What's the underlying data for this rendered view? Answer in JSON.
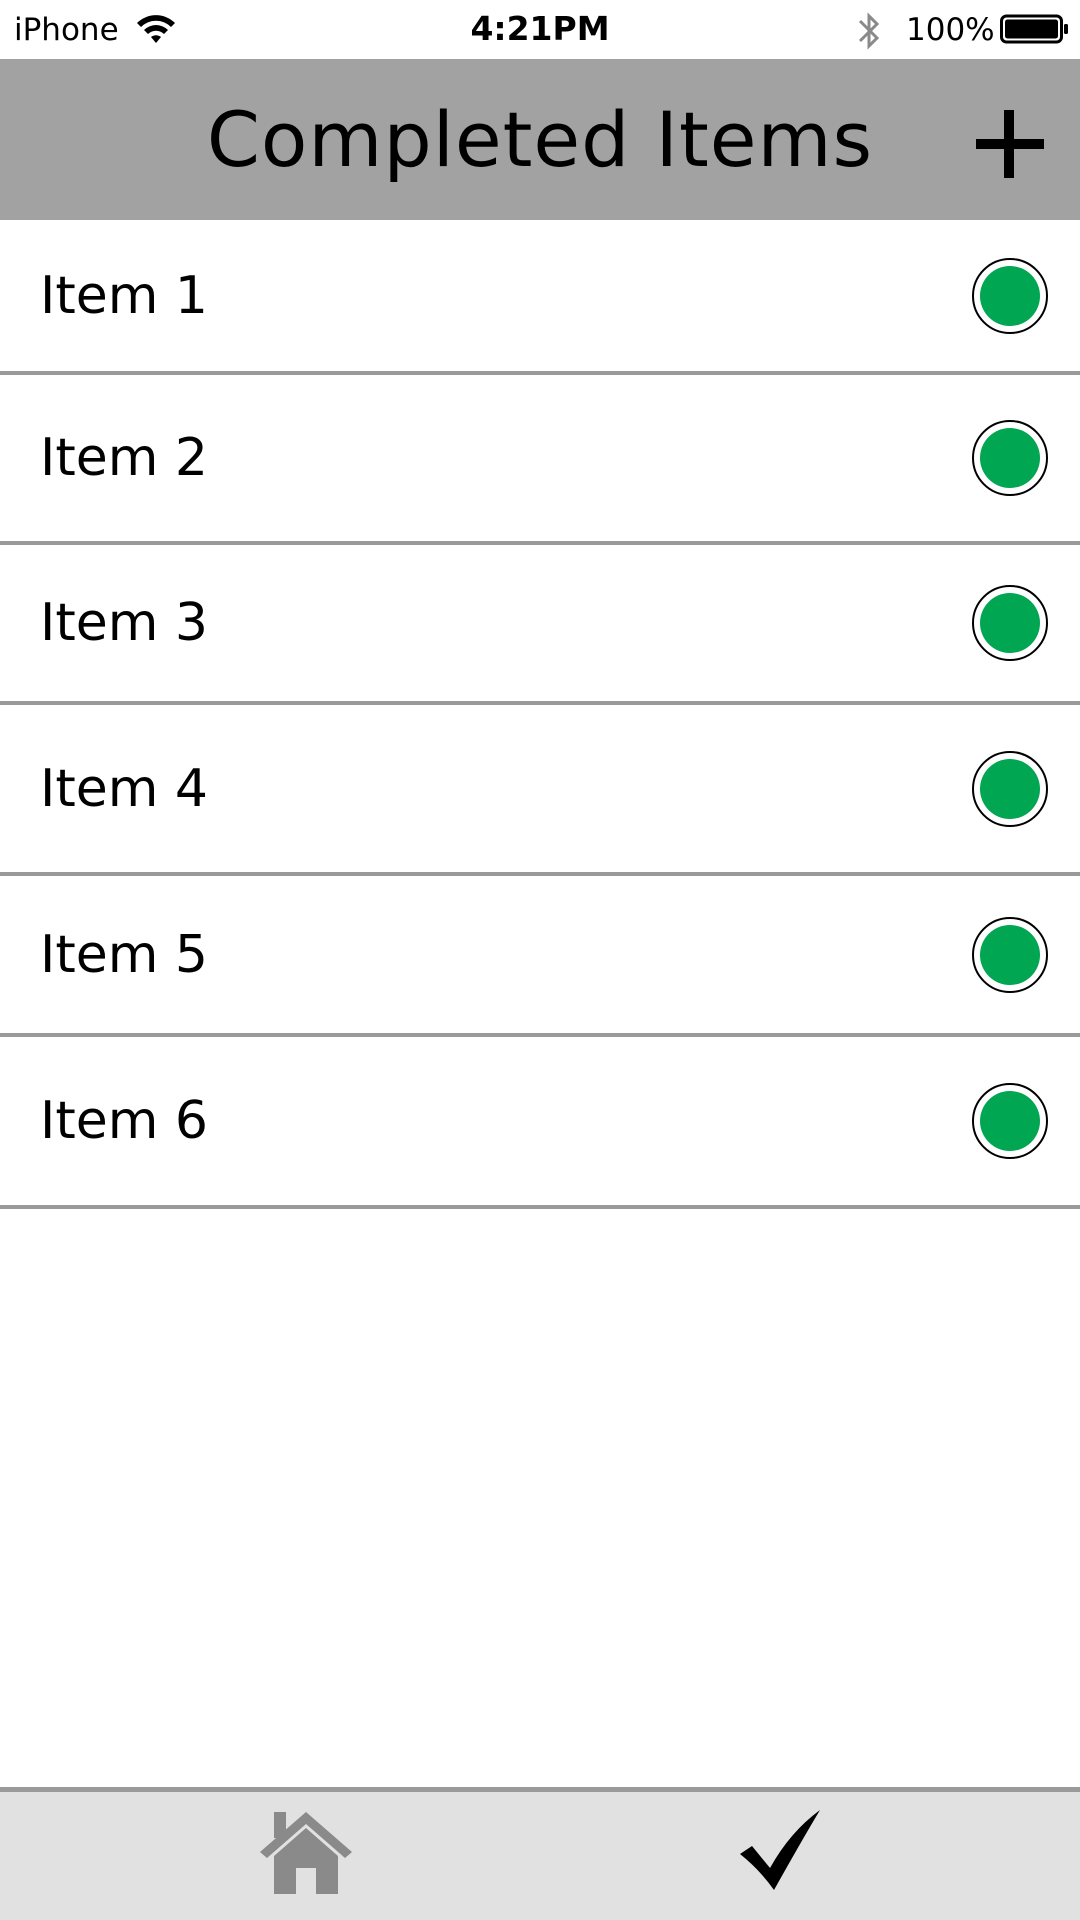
{
  "status_bar": {
    "carrier": "iPhone",
    "time": "4:21PM",
    "battery_percent": "100%",
    "icons": [
      "wifi-icon",
      "bluetooth-icon",
      "battery-icon"
    ]
  },
  "header": {
    "title": "Completed Items",
    "add_icon": "plus-icon",
    "background": "#a2a2a2"
  },
  "items": [
    {
      "label": "Item 1",
      "status": "completed",
      "status_color": "#00a651"
    },
    {
      "label": "Item 2",
      "status": "completed",
      "status_color": "#00a651"
    },
    {
      "label": "Item 3",
      "status": "completed",
      "status_color": "#00a651"
    },
    {
      "label": "Item 4",
      "status": "completed",
      "status_color": "#00a651"
    },
    {
      "label": "Item 5",
      "status": "completed",
      "status_color": "#00a651"
    },
    {
      "label": "Item 6",
      "status": "completed",
      "status_color": "#00a651"
    }
  ],
  "tab_bar": {
    "tabs": [
      {
        "icon": "home-icon",
        "active": false,
        "color": "#8a8a8a"
      },
      {
        "icon": "checkmark-icon",
        "active": true,
        "color": "#000000"
      }
    ],
    "background": "#e1e1e1"
  }
}
